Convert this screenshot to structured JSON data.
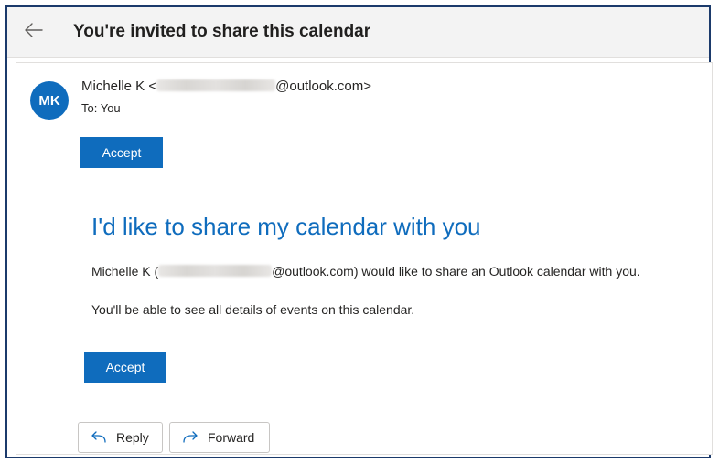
{
  "header": {
    "back_icon": "arrow-left-icon",
    "subject": "You're invited to share this calendar"
  },
  "message": {
    "avatar_initials": "MK",
    "sender_name": "Michelle K <",
    "sender_domain": "@outlook.com>",
    "to_line": "To: You",
    "accept_label": "Accept"
  },
  "body": {
    "title": "I'd like to share my calendar with you",
    "line1_prefix": "Michelle K (",
    "line1_suffix": "@outlook.com) would like to share an Outlook calendar with you.",
    "line2": "You'll be able to see all details of events on this calendar.",
    "accept_label": "Accept"
  },
  "actions": {
    "reply_label": "Reply",
    "reply_icon": "reply-arrow-icon",
    "forward_label": "Forward",
    "forward_icon": "forward-arrow-icon"
  },
  "colors": {
    "accent": "#0f6cbd",
    "frame_border": "#1b3a6b",
    "header_bg": "#f3f3f3"
  }
}
